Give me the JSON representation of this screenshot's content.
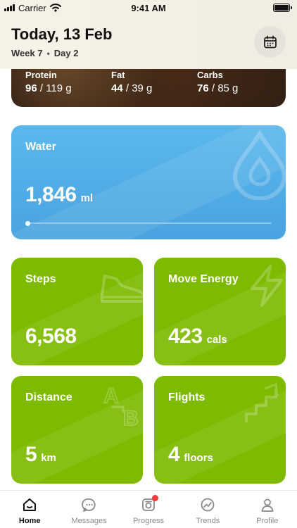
{
  "status": {
    "carrier": "Carrier",
    "time": "9:41 AM"
  },
  "header": {
    "title": "Today, 13 Feb",
    "week": "Week 7",
    "day": "Day 2",
    "calendar_icon": "calendar-icon"
  },
  "macros": [
    {
      "label": "Protein",
      "current": "96",
      "goal": "/ 119 g"
    },
    {
      "label": "Fat",
      "current": "44",
      "goal": "/ 39 g"
    },
    {
      "label": "Carbs",
      "current": "76",
      "goal": "/ 85 g"
    }
  ],
  "water": {
    "label": "Water",
    "value": "1,846",
    "unit": "ml",
    "progress": 0.0,
    "color": "#4aa3e0"
  },
  "steps": {
    "label": "Steps",
    "value": "6,568",
    "unit": ""
  },
  "move": {
    "label": "Move Energy",
    "value": "423",
    "unit": "cals"
  },
  "distance": {
    "label": "Distance",
    "value": "5",
    "unit": "km"
  },
  "flights": {
    "label": "Flights",
    "value": "4",
    "unit": "floors"
  },
  "colors": {
    "green": "#7dba00",
    "water": "#4aa3e0",
    "badge": "#ef3b3b"
  },
  "tabs": [
    {
      "label": "Home",
      "icon": "home-icon",
      "active": true
    },
    {
      "label": "Messages",
      "icon": "chat-icon",
      "active": false
    },
    {
      "label": "Progress",
      "icon": "progress-icon",
      "active": false,
      "badge": true
    },
    {
      "label": "Trends",
      "icon": "trends-icon",
      "active": false
    },
    {
      "label": "Profile",
      "icon": "profile-icon",
      "active": false
    }
  ]
}
